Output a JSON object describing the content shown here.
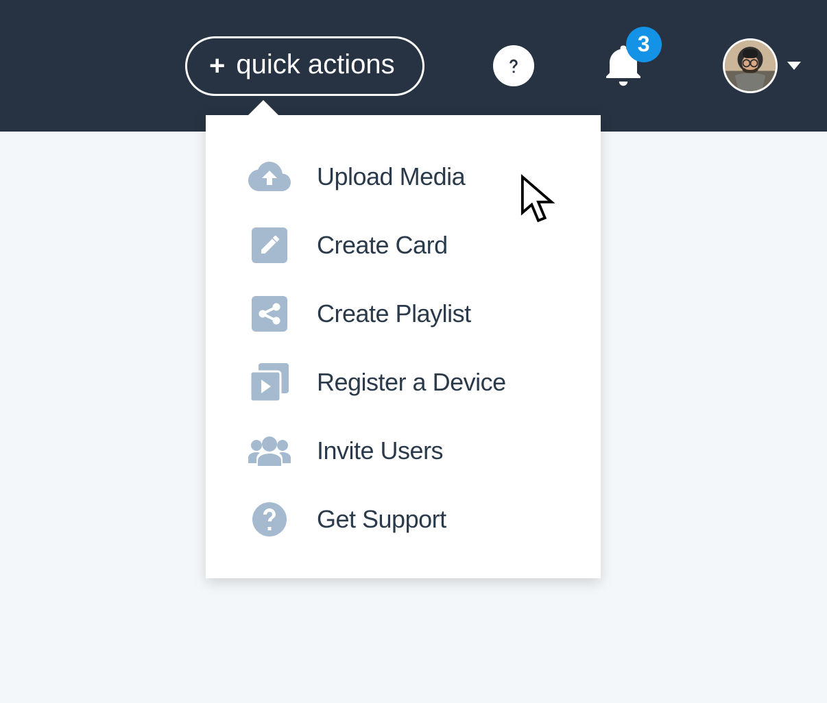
{
  "colors": {
    "header_bg": "#273342",
    "page_bg": "#f4f7f9",
    "icon_muted": "#a5bacf",
    "text_dark": "#2a3a4b",
    "badge_bg": "#1492e6"
  },
  "header": {
    "quick_actions_label": "quick actions",
    "notifications_count": "3"
  },
  "dropdown": {
    "items": [
      {
        "icon": "cloud-upload-icon",
        "label": "Upload Media"
      },
      {
        "icon": "pencil-square-icon",
        "label": "Create Card"
      },
      {
        "icon": "share-square-icon",
        "label": "Create Playlist"
      },
      {
        "icon": "device-play-icon",
        "label": "Register a Device"
      },
      {
        "icon": "users-icon",
        "label": "Invite Users"
      },
      {
        "icon": "help-circle-icon",
        "label": "Get Support"
      }
    ]
  }
}
